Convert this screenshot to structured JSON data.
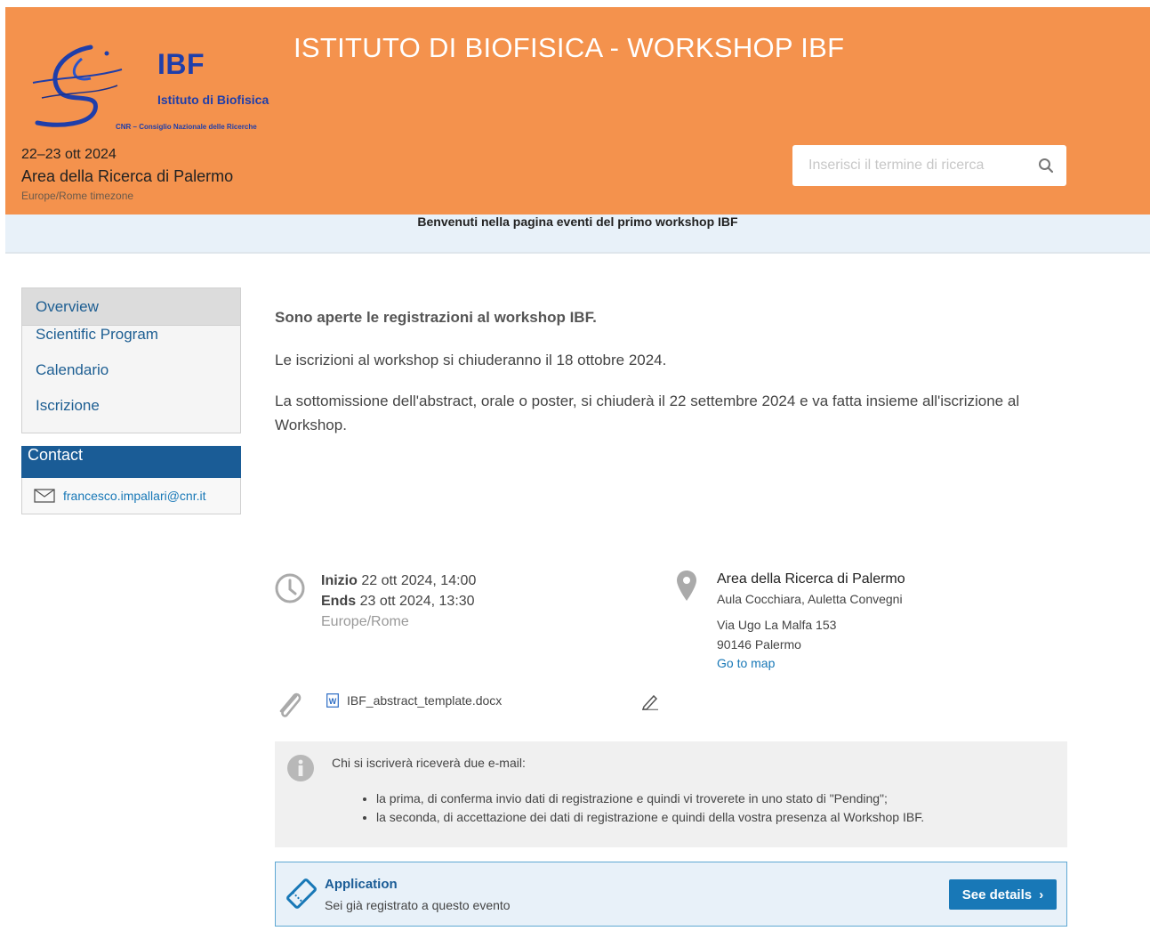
{
  "header": {
    "logo": {
      "abbr": "IBF",
      "name": "Istituto di Biofisica",
      "sub": "CNR – Consiglio Nazionale delle Ricerche"
    },
    "title": "ISTITUTO DI BIOFISICA - WORKSHOP IBF",
    "dates": "22–23 ott 2024",
    "venue": "Area della Ricerca di Palermo",
    "timezone": "Europe/Rome timezone",
    "search": {
      "placeholder": "Inserisci il termine di ricerca",
      "value": ""
    },
    "color": "#f4924d"
  },
  "announcement": "Benvenuti nella pagina eventi del primo workshop IBF",
  "sidebar": {
    "items": [
      {
        "label": "Overview",
        "active": true
      },
      {
        "label": "Scientific Program"
      },
      {
        "label": "Calendario"
      },
      {
        "label": "Iscrizione"
      }
    ],
    "contact_title": "Contact",
    "contact_email": "francesco.impallari@cnr.it"
  },
  "main": {
    "heading": "Sono aperte le registrazioni al workshop IBF.",
    "paragraph1": "Le iscrizioni al workshop si chiuderanno il 18 ottobre 2024.",
    "paragraph2": "La sottomissione dell'abstract, orale o poster,  si chiuderà il 22 settembre 2024 e va fatta insieme all'iscrizione al Workshop."
  },
  "details": {
    "start_label": "Inizio",
    "start_value": " 22 ott 2024, 14:00",
    "end_label": "Ends",
    "end_value": " 23 ott 2024, 13:30",
    "timezone": "Europe/Rome",
    "location_name": "Area della Ricerca di Palermo",
    "room": "Aula Cocchiara, Auletta Convegni",
    "address_line1": "Via Ugo La Malfa 153",
    "address_line2": "90146 Palermo",
    "map_link": "Go to map",
    "attachment": "IBF_abstract_template.docx"
  },
  "info": {
    "intro": "Chi si iscriverà riceverà due e-mail:",
    "items": [
      "la prima, di conferma invio dati di registrazione e quindi vi troverete in uno stato di \"Pending\";",
      "la seconda, di accettazione dei dati di registrazione e quindi della vostra presenza al Workshop IBF."
    ]
  },
  "application": {
    "title": "Application",
    "subtitle": "Sei già registrato a questo evento",
    "button": "See details"
  }
}
